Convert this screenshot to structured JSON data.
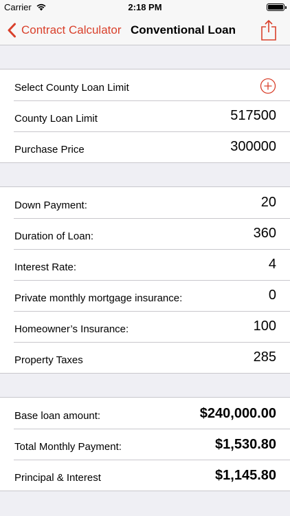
{
  "status_bar": {
    "carrier": "Carrier",
    "time": "2:18 PM"
  },
  "nav": {
    "back_label": "Contract Calculator",
    "title": "Conventional Loan",
    "accent_color": "#d9402b"
  },
  "section1": {
    "select_county_label": "Select County Loan Limit",
    "county_limit_label": "County Loan Limit",
    "county_limit_value": "517500",
    "purchase_price_label": "Purchase Price",
    "purchase_price_value": "300000"
  },
  "section2": {
    "down_payment_label": "Down Payment:",
    "down_payment_value": "20",
    "duration_label": "Duration of Loan:",
    "duration_value": "360",
    "interest_label": "Interest Rate:",
    "interest_value": "4",
    "pmi_label": "Private monthly mortgage insurance:",
    "pmi_value": "0",
    "homeowners_label": "Homeowner’s Insurance:",
    "homeowners_value": "100",
    "taxes_label": "Property Taxes",
    "taxes_value": "285"
  },
  "section3": {
    "base_loan_label": "Base loan amount:",
    "base_loan_value": "$240,000.00",
    "total_monthly_label": "Total Monthly Payment:",
    "total_monthly_value": "$1,530.80",
    "pi_label": "Principal & Interest",
    "pi_value": "$1,145.80"
  },
  "icons": {
    "wifi": "wifi-icon",
    "battery": "battery-icon",
    "back": "chevron-left-icon",
    "share": "share-icon",
    "add": "add-circle-icon"
  }
}
